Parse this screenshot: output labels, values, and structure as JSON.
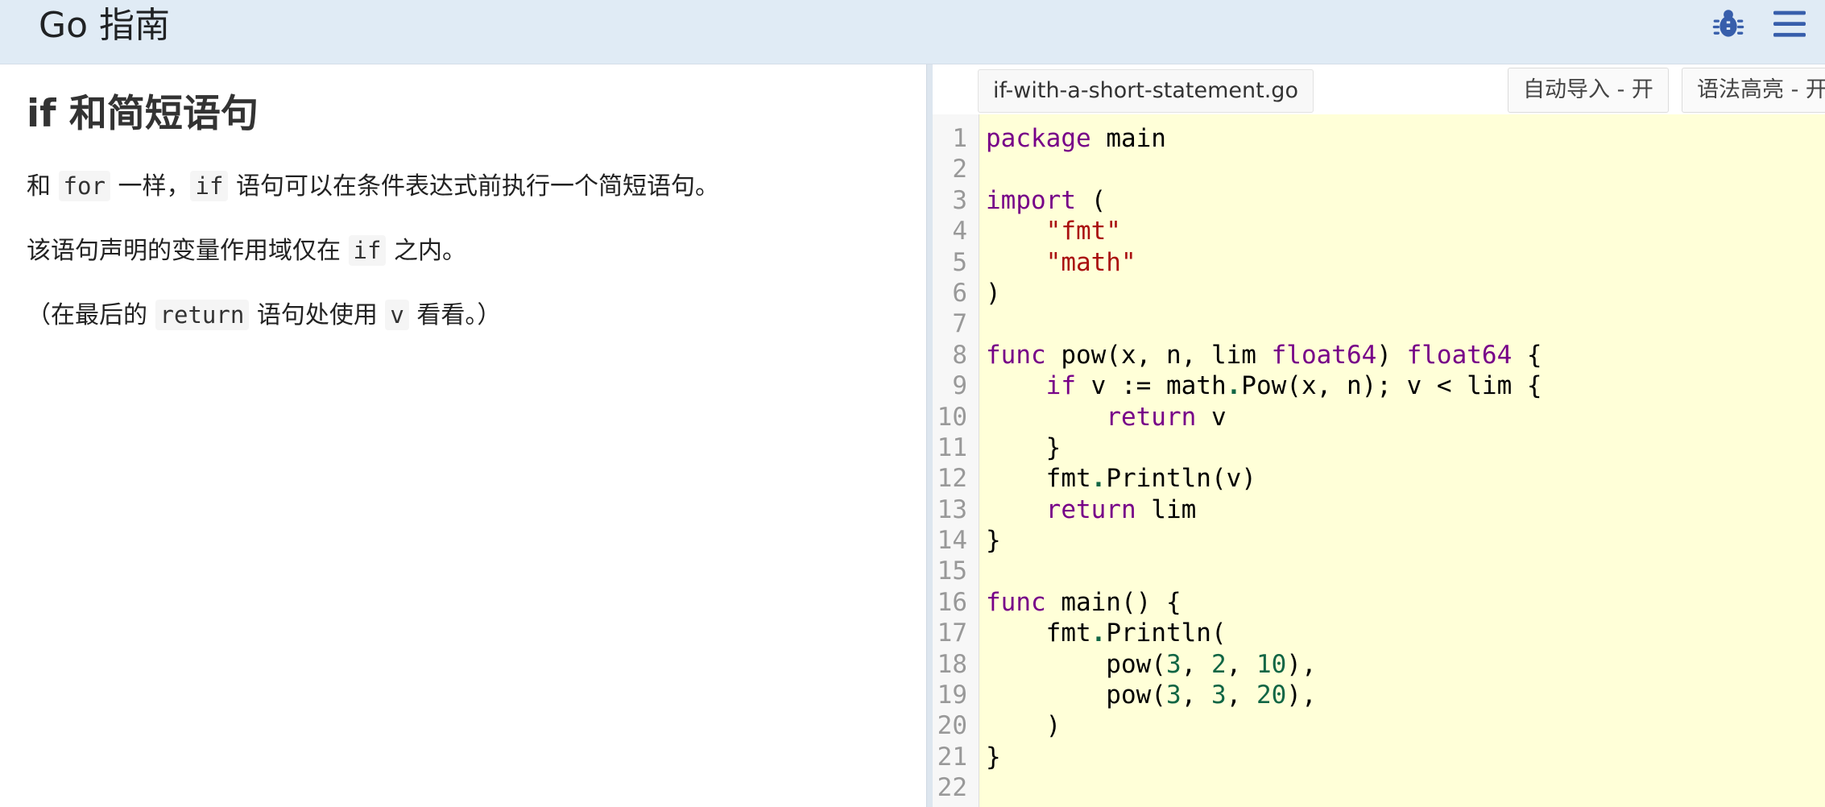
{
  "header": {
    "title": "Go 指南",
    "icons": [
      "bug-icon",
      "menu-icon"
    ],
    "background": "#e0ebf5",
    "icon_color": "#375eab"
  },
  "lesson": {
    "title": "if 和简短语句",
    "paragraphs": [
      [
        {
          "t": "text",
          "v": "和 "
        },
        {
          "t": "code",
          "v": "for"
        },
        {
          "t": "text",
          "v": " 一样，"
        },
        {
          "t": "code",
          "v": "if"
        },
        {
          "t": "text",
          "v": " 语句可以在条件表达式前执行一个简短语句。"
        }
      ],
      [
        {
          "t": "text",
          "v": "该语句声明的变量作用域仅在 "
        },
        {
          "t": "code",
          "v": "if"
        },
        {
          "t": "text",
          "v": " 之内。"
        }
      ],
      [
        {
          "t": "text",
          "v": "（在最后的 "
        },
        {
          "t": "code",
          "v": "return"
        },
        {
          "t": "text",
          "v": " 语句处使用 "
        },
        {
          "t": "code",
          "v": "v"
        },
        {
          "t": "text",
          "v": " 看看。）"
        }
      ]
    ]
  },
  "editor": {
    "filename": "if-with-a-short-statement.go",
    "auto_import_label": "自动导入 - 开",
    "syntax_highlight_label": "语法高亮 - 开",
    "background": "#ffffd8",
    "code_lines": [
      [
        [
          "kw",
          "package"
        ],
        [
          "pl",
          " main"
        ]
      ],
      [],
      [
        [
          "kw",
          "import"
        ],
        [
          "pl",
          " ("
        ]
      ],
      [
        [
          "pl",
          "    "
        ],
        [
          "str",
          "\"fmt\""
        ]
      ],
      [
        [
          "pl",
          "    "
        ],
        [
          "str",
          "\"math\""
        ]
      ],
      [
        [
          "pl",
          ")"
        ]
      ],
      [],
      [
        [
          "kw",
          "func"
        ],
        [
          "pl",
          " pow(x, n, lim "
        ],
        [
          "kw",
          "float64"
        ],
        [
          "pl",
          ") "
        ],
        [
          "kw",
          "float64"
        ],
        [
          "pl",
          " {"
        ]
      ],
      [
        [
          "pl",
          "    "
        ],
        [
          "kw",
          "if"
        ],
        [
          "pl",
          " v := math"
        ],
        [
          "op",
          "."
        ],
        [
          "pl",
          "Pow(x, n); v < lim {"
        ]
      ],
      [
        [
          "pl",
          "        "
        ],
        [
          "kw",
          "return"
        ],
        [
          "pl",
          " v"
        ]
      ],
      [
        [
          "pl",
          "    }"
        ]
      ],
      [
        [
          "pl",
          "    fmt"
        ],
        [
          "op",
          "."
        ],
        [
          "pl",
          "Println(v)"
        ]
      ],
      [
        [
          "pl",
          "    "
        ],
        [
          "kw",
          "return"
        ],
        [
          "pl",
          " lim"
        ]
      ],
      [
        [
          "pl",
          "}"
        ]
      ],
      [],
      [
        [
          "kw",
          "func"
        ],
        [
          "pl",
          " main() {"
        ]
      ],
      [
        [
          "pl",
          "    fmt"
        ],
        [
          "op",
          "."
        ],
        [
          "pl",
          "Println("
        ]
      ],
      [
        [
          "pl",
          "        pow("
        ],
        [
          "num",
          "3"
        ],
        [
          "pl",
          ", "
        ],
        [
          "num",
          "2"
        ],
        [
          "pl",
          ", "
        ],
        [
          "num",
          "10"
        ],
        [
          "pl",
          "),"
        ]
      ],
      [
        [
          "pl",
          "        pow("
        ],
        [
          "num",
          "3"
        ],
        [
          "pl",
          ", "
        ],
        [
          "num",
          "3"
        ],
        [
          "pl",
          ", "
        ],
        [
          "num",
          "20"
        ],
        [
          "pl",
          "),"
        ]
      ],
      [
        [
          "pl",
          "    )"
        ]
      ],
      [
        [
          "pl",
          "}"
        ]
      ],
      []
    ]
  }
}
